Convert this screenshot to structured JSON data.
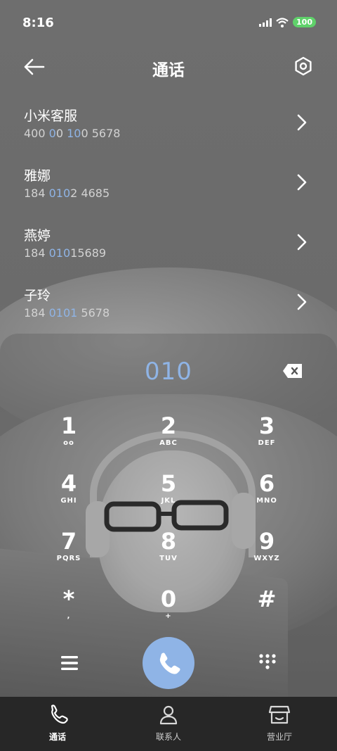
{
  "status": {
    "time": "8:16",
    "battery": "100"
  },
  "header": {
    "title": "通话"
  },
  "contacts": [
    {
      "name": "小米客服",
      "num_pre": "400 ",
      "num_hl1": "100",
      "num_mid": "",
      "num_post": " 5678",
      "hl_parts": [
        "0",
        "10"
      ],
      "display": "400 100 5678"
    },
    {
      "name": "雅娜",
      "num_pre": "184 ",
      "num_hl1": "010",
      "num_post": "2 4685"
    },
    {
      "name": "燕婷",
      "num_pre": "184 ",
      "num_hl1": "010",
      "num_post": "15689"
    },
    {
      "name": "子玲",
      "num_pre": "184 ",
      "num_hl1": "0101",
      "num_post": " 5678"
    }
  ],
  "dialer": {
    "entered": "010",
    "keys": [
      {
        "digit": "1",
        "letters": "ᴏᴏ"
      },
      {
        "digit": "2",
        "letters": "ABC"
      },
      {
        "digit": "3",
        "letters": "DEF"
      },
      {
        "digit": "4",
        "letters": "GHI"
      },
      {
        "digit": "5",
        "letters": "JKL"
      },
      {
        "digit": "6",
        "letters": "MNO"
      },
      {
        "digit": "7",
        "letters": "PQRS"
      },
      {
        "digit": "8",
        "letters": "TUV"
      },
      {
        "digit": "9",
        "letters": "WXYZ"
      },
      {
        "digit": "*",
        "letters": ","
      },
      {
        "digit": "0",
        "letters": "+"
      },
      {
        "digit": "#",
        "letters": ""
      }
    ]
  },
  "tabs": [
    {
      "label": "通话",
      "icon": "phone-icon"
    },
    {
      "label": "联系人",
      "icon": "person-icon"
    },
    {
      "label": "营业厅",
      "icon": "store-icon"
    }
  ],
  "colors": {
    "accent": "#8fb4e6",
    "tabbar": "#272727",
    "battery": "#5fd16a"
  }
}
